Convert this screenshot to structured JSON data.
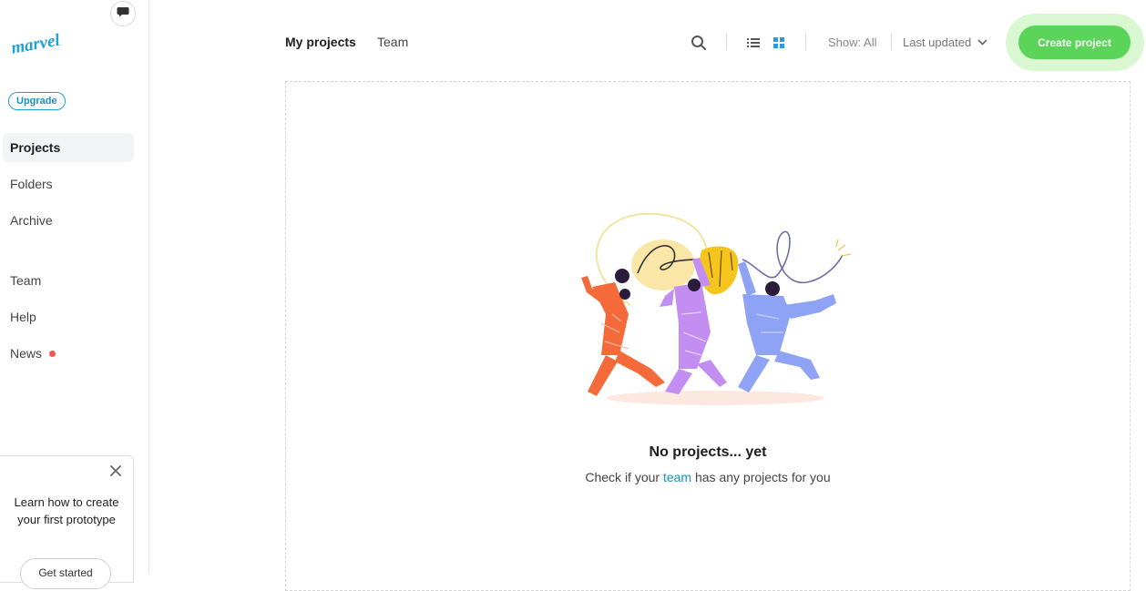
{
  "sidebar": {
    "logo_text": "marvel",
    "upgrade_label": "Upgrade",
    "items": [
      {
        "label": "Projects"
      },
      {
        "label": "Folders"
      },
      {
        "label": "Archive"
      },
      {
        "label": "Team"
      },
      {
        "label": "Help"
      },
      {
        "label": "News"
      }
    ],
    "tip": {
      "text": "Learn how to create your first prototype",
      "button_label": "Get started"
    }
  },
  "header": {
    "tabs": [
      {
        "label": "My projects"
      },
      {
        "label": "Team"
      }
    ],
    "show_filter": "Show: All",
    "sort_label": "Last updated",
    "create_label": "Create project"
  },
  "empty_state": {
    "title": "No projects... yet",
    "subtitle_before": "Check if your ",
    "subtitle_link": "team",
    "subtitle_after": " has any projects for you"
  },
  "colors": {
    "accent": "#5ad55a",
    "link": "#1a8fc4",
    "news_dot": "#f0574a"
  },
  "icons": {
    "chat": "chat-bubble-icon",
    "search": "search-icon",
    "list_view": "list-view-icon",
    "grid_view": "grid-view-icon",
    "sort": "chevron-down-icon",
    "close": "close-icon"
  }
}
